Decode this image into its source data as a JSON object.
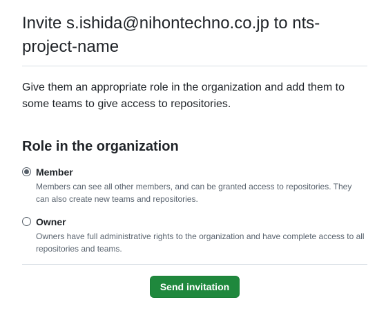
{
  "header": {
    "title": "Invite s.ishida@nihontechno.co.jp to nts-project-name"
  },
  "intro": {
    "text": "Give them an appropriate role in the organization and add them to some teams to give access to repositories."
  },
  "role_section": {
    "title": "Role in the organization",
    "selected": "member",
    "options": [
      {
        "id": "member",
        "label": "Member",
        "description": "Members can see all other members, and can be granted access to repositories. They can also create new teams and repositories."
      },
      {
        "id": "owner",
        "label": "Owner",
        "description": "Owners have full administrative rights to the organization and have complete access to all repositories and teams."
      }
    ]
  },
  "actions": {
    "send_label": "Send invitation"
  },
  "colors": {
    "primary_button": "#1f883d",
    "text": "#1f2328",
    "muted_text": "#59636e",
    "divider": "#d8dee4"
  }
}
